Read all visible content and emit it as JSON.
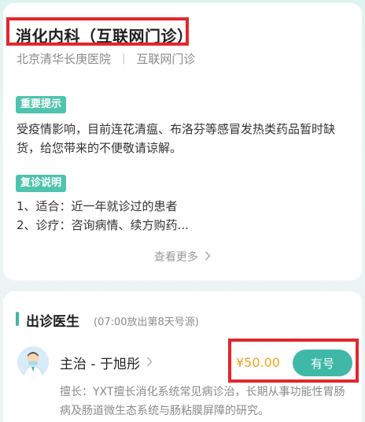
{
  "info_card": {
    "department_title": "消化内科（互联网门诊）",
    "hospital": "北京清华长庚医院",
    "separator": "|",
    "clinic_type": "互联网门诊",
    "notice_tag": "重要提示",
    "notice_text": "受疫情影响，目前连花清瘟、布洛芬等感冒发热类药品暂时缺货，给您带来的不便敬请谅解。",
    "revisit_tag": "复诊说明",
    "revisit_line1": "1、适合：近一年就诊过的患者",
    "revisit_line2": "2、诊疗：咨询病情、续方购药...",
    "see_more": "查看更多",
    "see_more_icon": "chevron-right-icon"
  },
  "doctor_section": {
    "title": "出诊医生",
    "note": "(07:00放出第8天号源)",
    "doctors": [
      {
        "name": "主治 - 于旭彤",
        "price": "¥50.00",
        "button_label": "有号",
        "description": "擅长：YXT擅长消化系统常见病诊治，长期从事功能性胃肠病及肠道微生态系统与肠粘膜屏障的研究。",
        "avatar_icon": "doctor-avatar-icon"
      }
    ]
  },
  "colors": {
    "accent": "#3fb8a8",
    "tag": "#4fc3ad",
    "price": "#f4a21b",
    "highlight_box": "#e3262c"
  }
}
